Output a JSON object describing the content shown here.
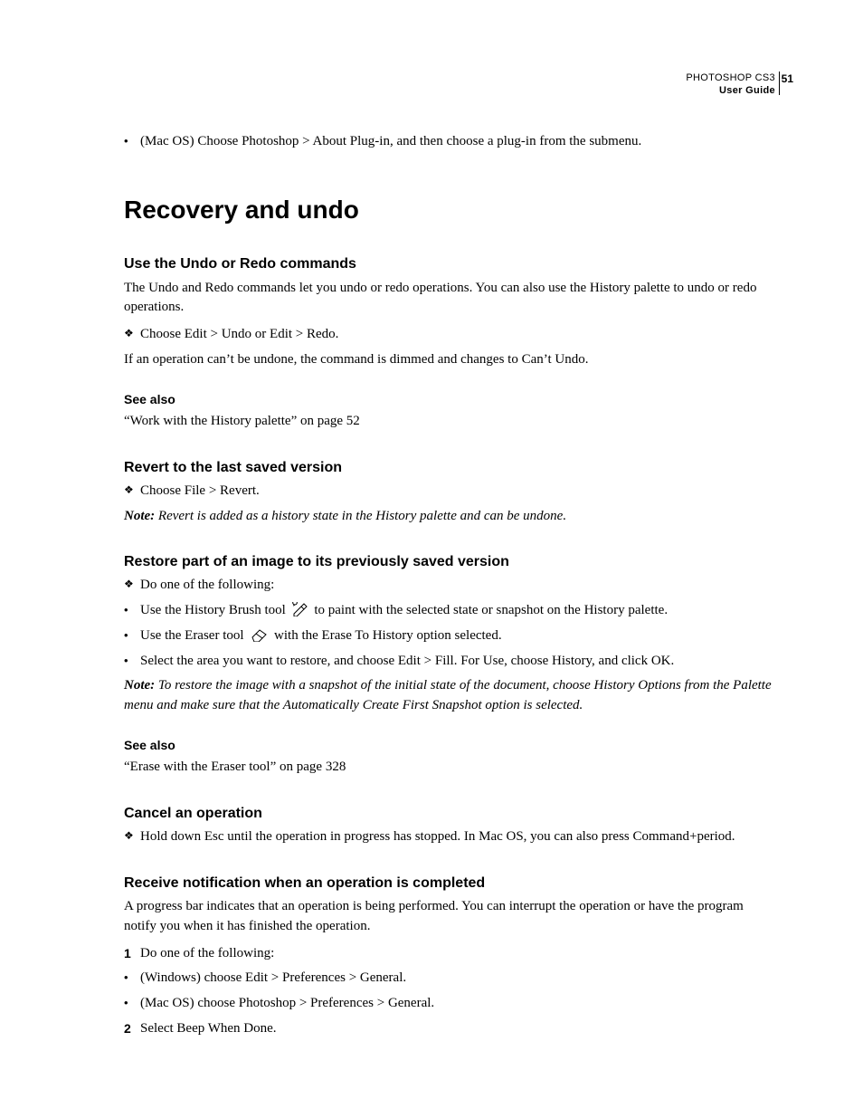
{
  "header": {
    "product": "PHOTOSHOP CS3",
    "doc": "User Guide",
    "page": "51"
  },
  "top_bullet": "(Mac OS) Choose Photoshop > About Plug-in, and then choose a plug-in from the submenu.",
  "section_title": "Recovery and undo",
  "s1": {
    "title": "Use the Undo or Redo commands",
    "intro": "The Undo and Redo commands let you undo or redo operations. You can also use the History palette to undo or redo operations.",
    "step": "Choose Edit > Undo or Edit > Redo.",
    "after": "If an operation can’t be undone, the command is dimmed and changes to Can’t Undo.",
    "seealso_h": "See also",
    "seealso": "“Work with the History palette” on page 52"
  },
  "s2": {
    "title": "Revert to the last saved version",
    "step": "Choose File > Revert.",
    "note_label": "Note:",
    "note": " Revert is added as a history state in the History palette and can be undone."
  },
  "s3": {
    "title": "Restore part of an image to its previously saved version",
    "lead": "Do one of the following:",
    "b1a": "Use the History Brush tool ",
    "b1b": " to paint with the selected state or snapshot on the History palette.",
    "b2a": "Use the Eraser tool ",
    "b2b": " with the Erase To History option selected.",
    "b3": "Select the area you want to restore, and choose Edit > Fill. For Use, choose History, and click OK.",
    "note_label": "Note:",
    "note": " To restore the image with a snapshot of the initial state of the document, choose History Options from the Palette menu and make sure that the Automatically Create First Snapshot option is selected.",
    "seealso_h": "See also",
    "seealso": "“Erase with the Eraser tool” on page 328"
  },
  "s4": {
    "title": "Cancel an operation",
    "step": "Hold down Esc until the operation in progress has stopped. In Mac OS, you can also press Command+period."
  },
  "s5": {
    "title": "Receive notification when an operation is completed",
    "intro": "A progress bar indicates that an operation is being performed. You can interrupt the operation or have the program notify you when it has finished the operation.",
    "n1": "Do one of the following:",
    "b1": "(Windows) choose Edit > Preferences > General.",
    "b2": "(Mac OS) choose Photoshop > Preferences > General.",
    "n2": "Select Beep When Done."
  }
}
